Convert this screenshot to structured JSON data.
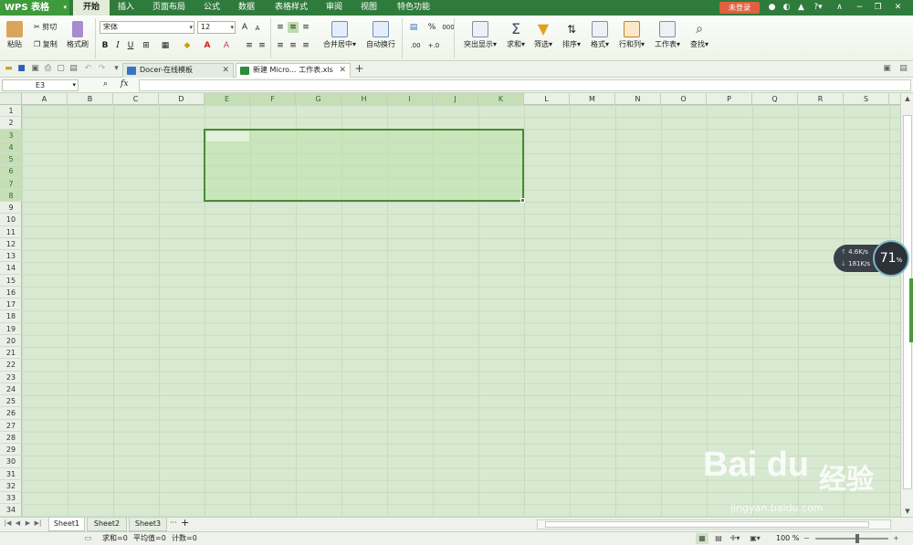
{
  "app": {
    "logo": "WPS 表格"
  },
  "menu_tabs": [
    "开始",
    "插入",
    "页面布局",
    "公式",
    "数据",
    "表格样式",
    "审阅",
    "视图",
    "特色功能"
  ],
  "title_right": {
    "login": "未登录",
    "help": "?"
  },
  "ribbon": {
    "paste": "粘贴",
    "cut": "剪切",
    "copy": "复制",
    "format_painter": "格式刷",
    "font_name": "宋体",
    "font_size": "12",
    "bold": "B",
    "italic": "I",
    "underline": "U",
    "merge_center": "合并居中",
    "wrap_text": "自动换行",
    "percent": "%",
    "thousands": "000",
    "dec_inc": ".00",
    "dec_dec": "+.0",
    "conditional": "突出显示",
    "sum": "求和",
    "filter": "筛选",
    "sort": "排序",
    "format": "格式",
    "rows_cols": "行和列",
    "worksheet": "工作表",
    "find": "查找"
  },
  "doc_tabs": [
    {
      "label": "Docer-在线模板",
      "active": false
    },
    {
      "label": "新建 Micro... 工作表.xls",
      "active": true
    }
  ],
  "formula_bar": {
    "name_box": "E3",
    "fx": "fx",
    "value": ""
  },
  "columns": [
    "A",
    "B",
    "C",
    "D",
    "E",
    "F",
    "G",
    "H",
    "I",
    "J",
    "K",
    "L",
    "M",
    "N",
    "O",
    "P",
    "Q",
    "R",
    "S"
  ],
  "selected_columns": [
    "E",
    "F",
    "G",
    "H",
    "I",
    "J",
    "K"
  ],
  "rows": [
    "1",
    "2",
    "3",
    "4",
    "5",
    "6",
    "7",
    "8",
    "9",
    "10",
    "11",
    "12",
    "13",
    "14",
    "15",
    "16",
    "17",
    "18",
    "19",
    "20",
    "21",
    "22",
    "23",
    "24",
    "25",
    "26",
    "27",
    "28",
    "29",
    "30",
    "31",
    "32",
    "33",
    "34"
  ],
  "selected_rows": [
    "3",
    "4",
    "5",
    "6",
    "7",
    "8"
  ],
  "sheets": [
    {
      "label": "Sheet1",
      "active": true
    },
    {
      "label": "Sheet2",
      "active": false
    },
    {
      "label": "Sheet3",
      "active": false
    }
  ],
  "sheet_more": "···",
  "sheet_add": "+",
  "status": {
    "sum": "求和=0",
    "average": "平均值=0",
    "count": "计数=0",
    "zoom": "100 %"
  },
  "speed_widget": {
    "upload": "4.6K/s",
    "download": "181K/s",
    "value": "71",
    "unit": "%"
  },
  "watermark": {
    "logo": "Bai du",
    "cn": "经验",
    "url": "jingyan.baidu.com"
  },
  "colors": {
    "accent": "#2f7b3c",
    "login": "#e0613f",
    "selection_border": "#4a8a35"
  }
}
